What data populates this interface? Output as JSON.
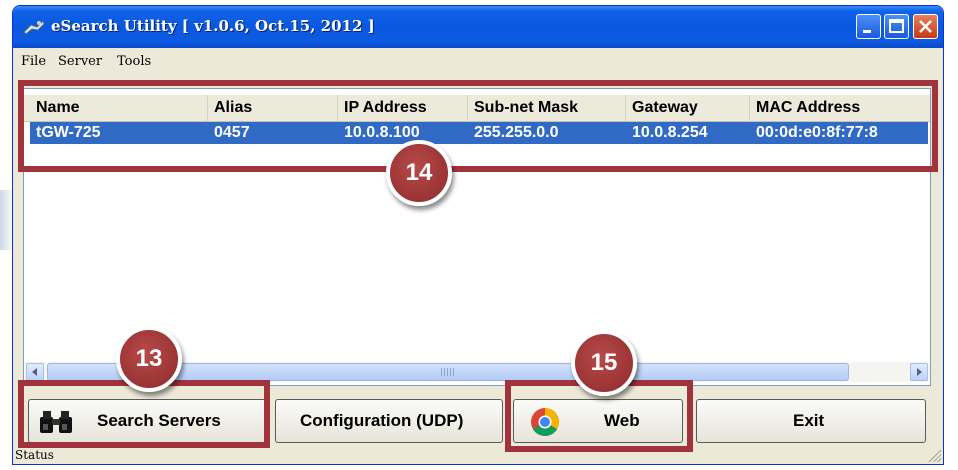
{
  "window": {
    "title": "eSearch Utility [ v1.0.6, Oct.15, 2012 ]"
  },
  "menu": [
    "File",
    "Server",
    "Tools"
  ],
  "table": {
    "columns": [
      "Name",
      "Alias",
      "IP Address",
      "Sub-net Mask",
      "Gateway",
      "MAC Address"
    ],
    "rows": [
      [
        "tGW-725",
        "0457",
        "10.0.8.100",
        "255.255.0.0",
        "10.0.8.254",
        "00:0d:e0:8f:77:8"
      ]
    ]
  },
  "buttons": {
    "search": "Search Servers",
    "config": "Configuration (UDP)",
    "web": "Web",
    "exit": "Exit"
  },
  "status": "Status",
  "callouts": [
    "14",
    "13",
    "15"
  ],
  "colors": {
    "callout": "#a0333b",
    "selection": "#316ac5",
    "titlebar": "#0a58e0"
  },
  "icons": [
    "app-icon",
    "binoculars-icon",
    "chrome-icon",
    "scroll-left-arrow-icon",
    "scroll-right-arrow-icon"
  ]
}
